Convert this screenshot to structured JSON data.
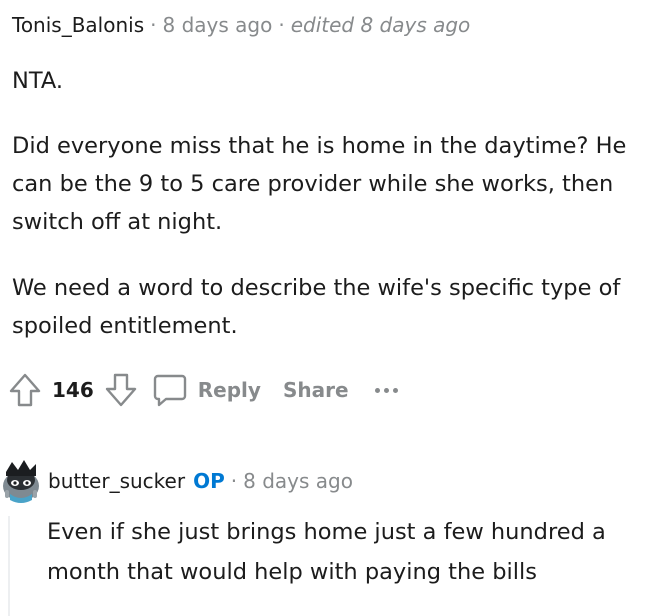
{
  "comment": {
    "author": "Tonis_Balonis",
    "separator": "·",
    "time": "8 days ago",
    "edited": "edited 8 days ago",
    "paragraphs": [
      "NTA.",
      "Did everyone miss that he is home in the daytime? He can be the 9 to 5 care provider while she works, then switch off at night.",
      "We need a word to describe the wife's specific type of spoiled entitlement."
    ],
    "score": "146",
    "reply_label": "Reply",
    "share_label": "Share",
    "icons": {
      "upvote": "upvote-arrow-icon",
      "downvote": "downvote-arrow-icon",
      "reply": "speech-bubble-icon",
      "more": "ellipsis-icon"
    }
  },
  "reply": {
    "author": "butter_sucker",
    "op_badge": "OP",
    "separator": "·",
    "time": "8 days ago",
    "paragraphs": [
      "Even if she just brings home just a few hundred a month that would help with paying the bills"
    ],
    "avatar": "snoo-avatar-icon"
  },
  "colors": {
    "text": "#1c1c1c",
    "muted": "#878a8c",
    "op_blue": "#0079d3",
    "thread_line": "#edeff1"
  }
}
